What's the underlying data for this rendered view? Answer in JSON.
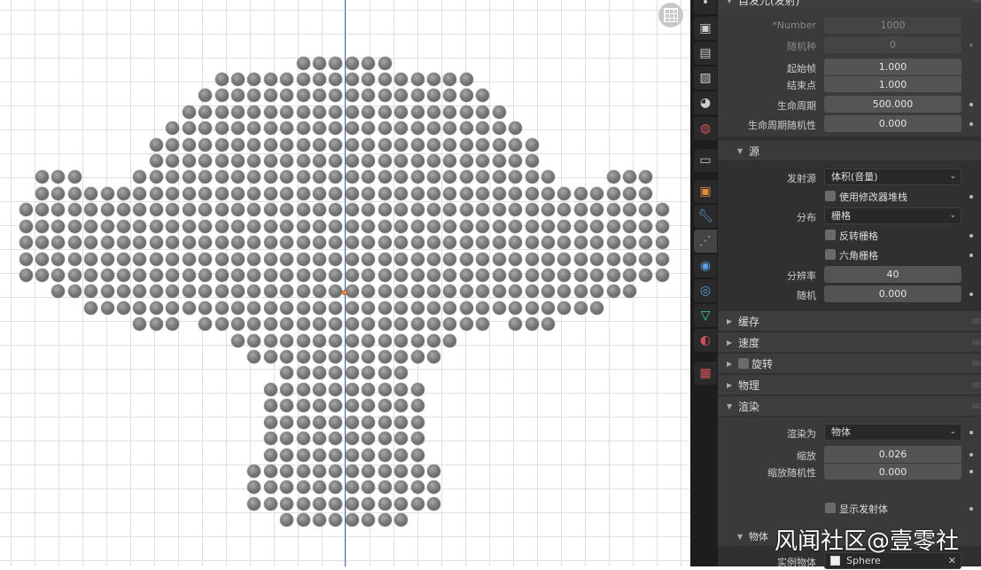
{
  "viewport": {
    "grid_toggle_icon": "grid-icon"
  },
  "panel": {
    "emission": {
      "title": "自发元(发射)",
      "number_label": "*Number",
      "number_value": "1000",
      "seed_label": "随机种",
      "seed_value": "0",
      "frame_start_label": "起始帧",
      "frame_start_value": "1.000",
      "frame_end_label": "结束点",
      "frame_end_value": "1.000",
      "lifetime_label": "生命周期",
      "lifetime_value": "500.000",
      "lifetime_random_label": "生命周期随机性",
      "lifetime_random_value": "0.000"
    },
    "source": {
      "title": "源",
      "emit_from_label": "发射源",
      "emit_from_value": "体积(音量)",
      "use_modifier_stack_label": "使用修改器堆栈",
      "distribution_label": "分布",
      "distribution_value": "栅格",
      "invert_grid_label": "反转栅格",
      "hexagonal_grid_label": "六角栅格",
      "resolution_label": "分辨率",
      "resolution_value": "40",
      "random_label": "随机",
      "random_value": "0.000"
    },
    "collapsed": [
      "缓存",
      "速度",
      "旋转",
      "物理"
    ],
    "render": {
      "title": "渲染",
      "render_as_label": "渲染为",
      "render_as_value": "物体",
      "scale_label": "缩放",
      "scale_value": "0.026",
      "scale_random_label": "缩放随机性",
      "scale_random_value": "0.000",
      "show_emitter_label": "显示发射体"
    },
    "object": {
      "title": "物体",
      "instance_object_label": "实例物体",
      "instance_object_value": "Sphere"
    }
  },
  "watermark": "风闻社区@壹零社",
  "colors": {
    "accent": "#4772b3",
    "origin": "#f0901c"
  }
}
